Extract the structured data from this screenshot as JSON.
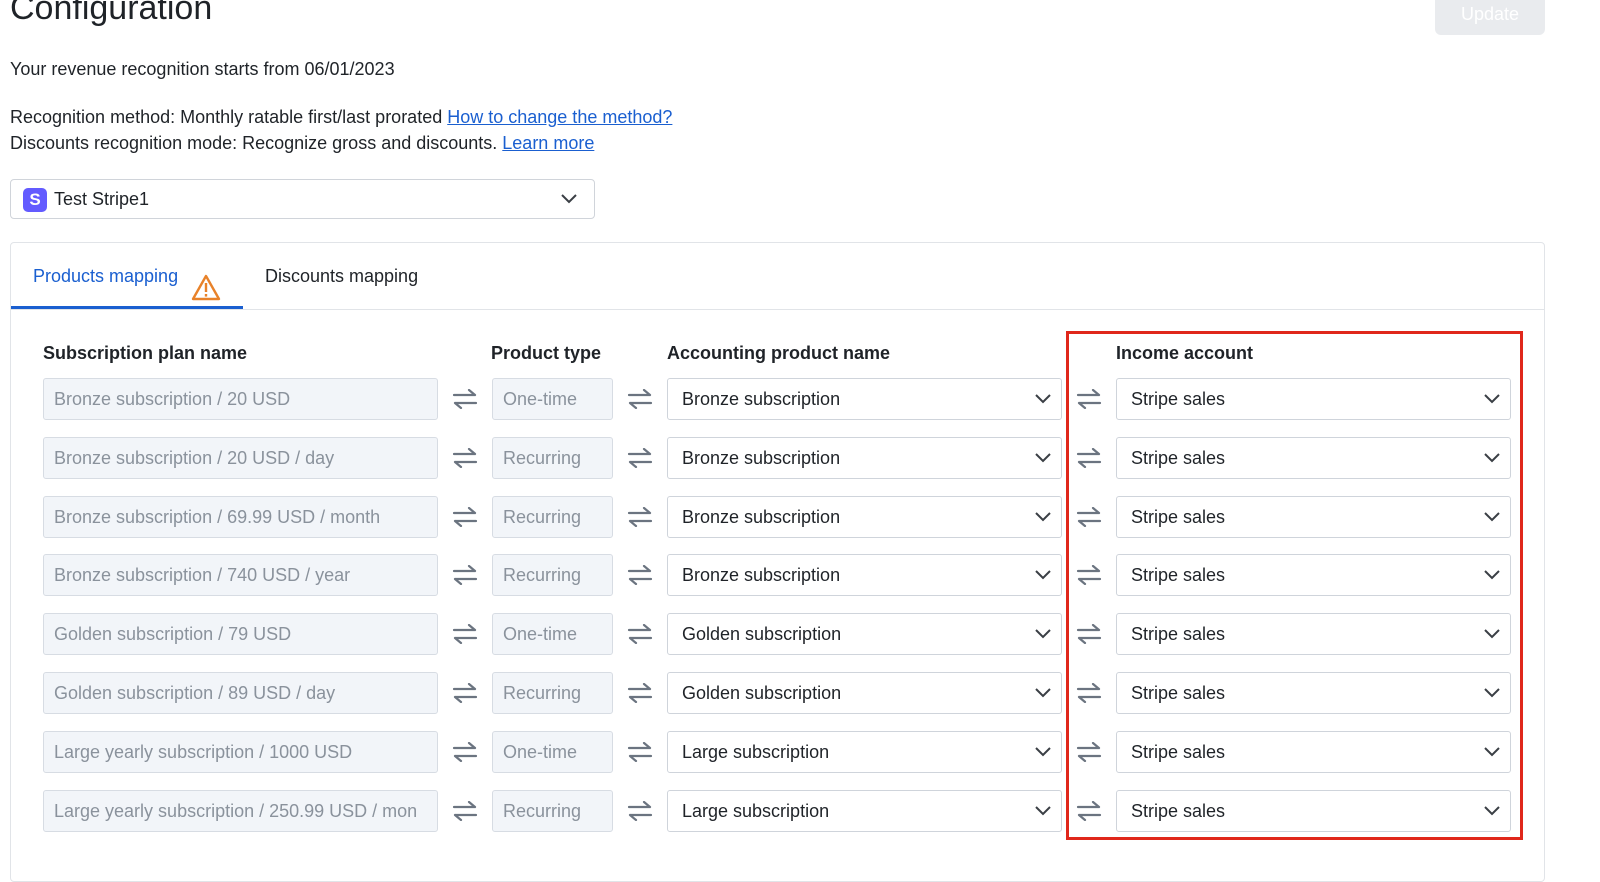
{
  "page": {
    "title": "Configuration",
    "update_label": "Update"
  },
  "info": {
    "start_text": "Your revenue recognition starts from 06/01/2023",
    "method_text": "Recognition method: Monthly ratable first/last prorated ",
    "method_link": "How to change the method?",
    "discount_text": "Discounts recognition mode: Recognize gross and discounts. ",
    "discount_link": "Learn more"
  },
  "account_select": {
    "logo_letter": "S",
    "value": "Test Stripe1"
  },
  "tabs": [
    {
      "label": "Products mapping",
      "active": true,
      "warning": true
    },
    {
      "label": "Discounts mapping",
      "active": false
    }
  ],
  "columns": {
    "plan": "Subscription plan name",
    "type": "Product type",
    "product": "Accounting product name",
    "income": "Income account"
  },
  "rows": [
    {
      "plan": "Bronze subscription / 20 USD",
      "type": "One-time",
      "product": "Bronze subscription",
      "income": "Stripe sales"
    },
    {
      "plan": "Bronze subscription / 20 USD / day",
      "type": "Recurring",
      "product": "Bronze subscription",
      "income": "Stripe sales"
    },
    {
      "plan": "Bronze subscription / 69.99 USD / month",
      "type": "Recurring",
      "product": "Bronze subscription",
      "income": "Stripe sales"
    },
    {
      "plan": "Bronze subscription / 740 USD / year",
      "type": "Recurring",
      "product": "Bronze subscription",
      "income": "Stripe sales"
    },
    {
      "plan": "Golden subscription / 79 USD",
      "type": "One-time",
      "product": "Golden subscription",
      "income": "Stripe sales"
    },
    {
      "plan": "Golden subscription / 89 USD / day",
      "type": "Recurring",
      "product": "Golden subscription",
      "income": "Stripe sales"
    },
    {
      "plan": "Large yearly subscription / 1000 USD",
      "type": "One-time",
      "product": "Large subscription",
      "income": "Stripe sales"
    },
    {
      "plan": "Large yearly subscription / 250.99 USD / mon",
      "type": "Recurring",
      "product": "Large subscription",
      "income": "Stripe sales"
    }
  ],
  "colors": {
    "link": "#1a5fd0",
    "highlight": "#e0271b",
    "warning": "#e8822a",
    "stripe": "#635bff"
  },
  "icons": {
    "swap": "swap-arrows-icon",
    "dropdown": "chevron-down-icon",
    "warning": "warning-triangle-icon"
  }
}
